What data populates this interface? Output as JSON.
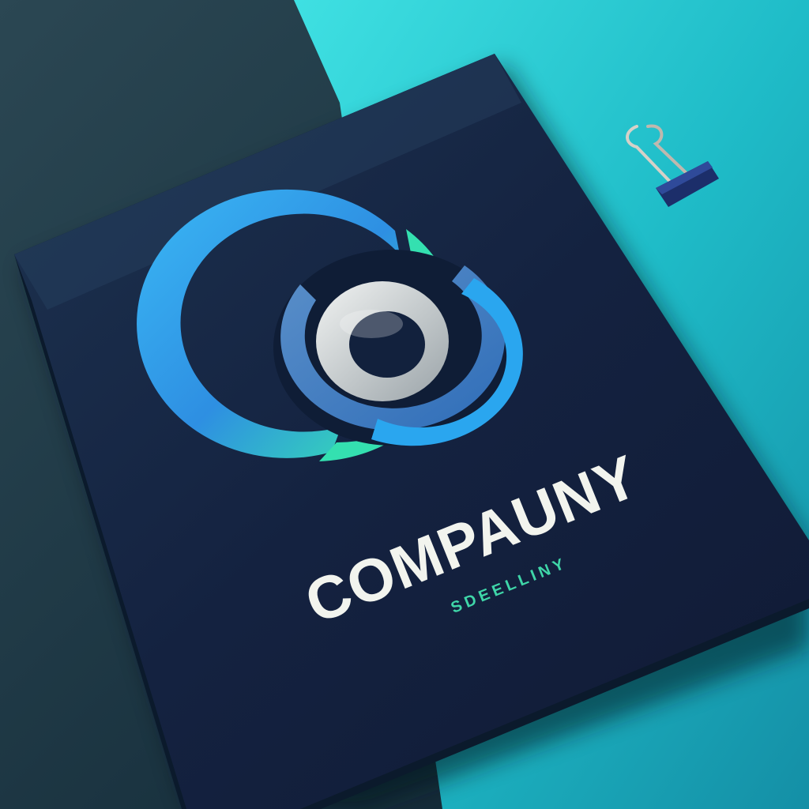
{
  "logo": {
    "company_name": "COMPAUNY",
    "tagline": "SDEELLINY"
  },
  "colors": {
    "backdrop_dark": "#1b3440",
    "backdrop_teal": "#22c4cf",
    "card_navy": "#13213f",
    "ring_blue": "#36a8f0",
    "ring_green": "#2fe0b0",
    "ring_silver": "#d9dde0",
    "wordmark": "#f2f4ee",
    "tagline": "#3fd6a8"
  },
  "icons": {
    "logo_mark": "concentric-ring-icon",
    "clip": "binder-clip-icon"
  }
}
